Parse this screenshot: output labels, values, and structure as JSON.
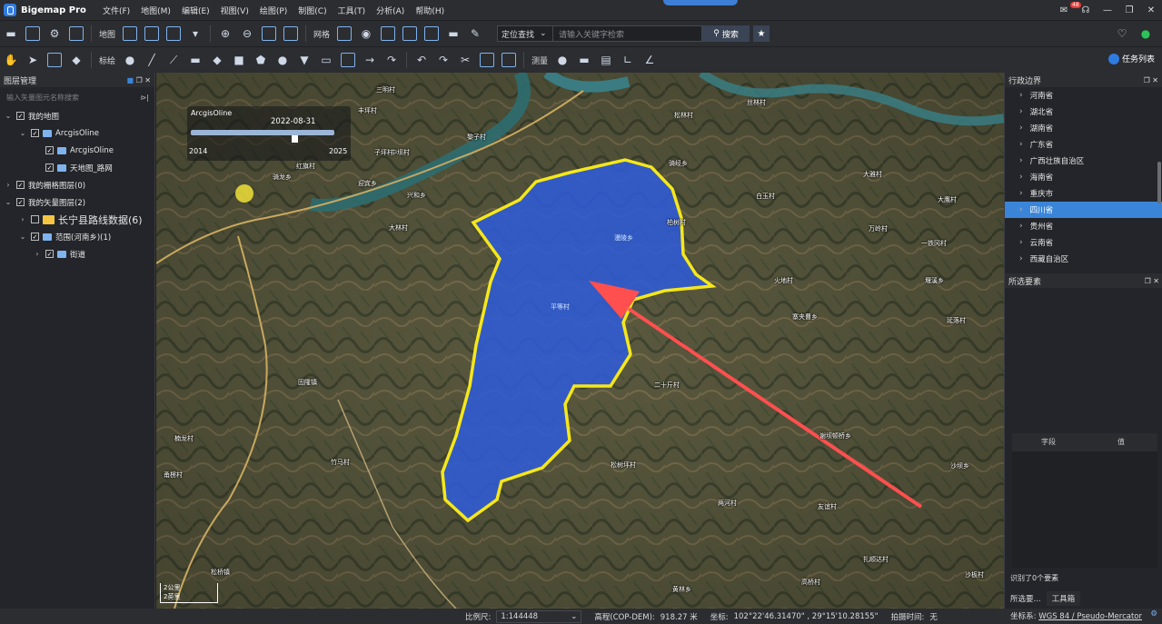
{
  "app": {
    "title": "Bigemap Pro",
    "notification_count": "48"
  },
  "menu": [
    "文件(F)",
    "地图(M)",
    "编辑(E)",
    "视图(V)",
    "绘图(P)",
    "制图(C)",
    "工具(T)",
    "分析(A)",
    "帮助(H)"
  ],
  "toolbar1": {
    "map_label": "地图",
    "grid_label": "网格",
    "search_mode": "定位查找",
    "search_placeholder": "请输入关键字检索",
    "search_button": "搜索"
  },
  "toolbar2": {
    "mark_label": "标绘",
    "measure_label": "测量",
    "task_list": "任务列表"
  },
  "layer_panel": {
    "title": "图层管理",
    "search_placeholder": "输入矢量图元名称搜索",
    "tree": [
      {
        "label": "我的地图",
        "level": 0,
        "checked": true,
        "expanded": true
      },
      {
        "label": "ArcgisOline",
        "level": 1,
        "checked": true,
        "expanded": true
      },
      {
        "label": "ArcgisOline",
        "level": 2,
        "checked": true
      },
      {
        "label": "天地图_路网",
        "level": 2,
        "checked": true
      },
      {
        "label": "我的栅格图层(0)",
        "level": 0,
        "checked": true
      },
      {
        "label": "我的矢量图层(2)",
        "level": 0,
        "checked": true,
        "expanded": true
      },
      {
        "label": "长宁县路线数据(6)",
        "level": 1,
        "checked": false
      },
      {
        "label": "范围(河南乡)(1)",
        "level": 1,
        "checked": true,
        "expanded": true
      },
      {
        "label": "街道",
        "level": 2,
        "checked": true
      }
    ]
  },
  "timeline": {
    "source": "ArcgisOline",
    "current_date": "2022-08-31",
    "start_year": "2014",
    "end_year": "2025",
    "position": 0.72
  },
  "map_labels": [
    "三明村",
    "丰坪村",
    "红旗村",
    "中坝村",
    "骑龙乡",
    "子坪村",
    "迎宾乡",
    "兴和乡",
    "大林村",
    "黎子村",
    "松林村",
    "丝林村",
    "骑经乡",
    "大雅村",
    "大鹰村",
    "柏树村",
    "白玉村",
    "万岭村",
    "一铁冈村",
    "火地村",
    "堰溪乡",
    "寨夹曹乡",
    "延落村",
    "二十斤村",
    "固隆镇",
    "楠龙村",
    "甬楞村",
    "竹马村",
    "松树坪村",
    "谢坝顿桥乡",
    "沙坝乡",
    "两河村",
    "友谊村",
    "扎顺达村",
    "高桥村",
    "黄林乡",
    "沙板村",
    "松桥镇"
  ],
  "polygon_labels": [
    "漫陵乡",
    "平等村"
  ],
  "scale_bar": {
    "km": "2公里",
    "mi": "2英里"
  },
  "admin_panel": {
    "title": "行政边界",
    "provinces": [
      "河南省",
      "湖北省",
      "湖南省",
      "广东省",
      "广西壮族自治区",
      "海南省",
      "重庆市",
      "四川省",
      "贵州省",
      "云南省",
      "西藏自治区"
    ],
    "selected": "四川省"
  },
  "selected_panel": {
    "title": "所选要素",
    "col_field": "字段",
    "col_value": "值",
    "identified": "识别了0个要素",
    "tabs": [
      "所选要...",
      "工具箱"
    ]
  },
  "status": {
    "scale_label": "比例尺:",
    "scale_value": "1:144448",
    "elevation_label": "高程(COP-DEM):",
    "elevation_value": "918.27 米",
    "coord_label": "坐标:",
    "coord_value": "102°22'46.31470\" , 29°15'10.28155\"",
    "time_label": "拍摄时间:",
    "time_value": "无",
    "crs_label": "坐标系:",
    "crs_value": "WGS 84 / Pseudo-Mercator"
  },
  "colors": {
    "polygon_fill": "#2f5bd6",
    "polygon_border": "#f5e71a",
    "arrow": "#ff4f4f",
    "accent": "#3a85d8"
  }
}
